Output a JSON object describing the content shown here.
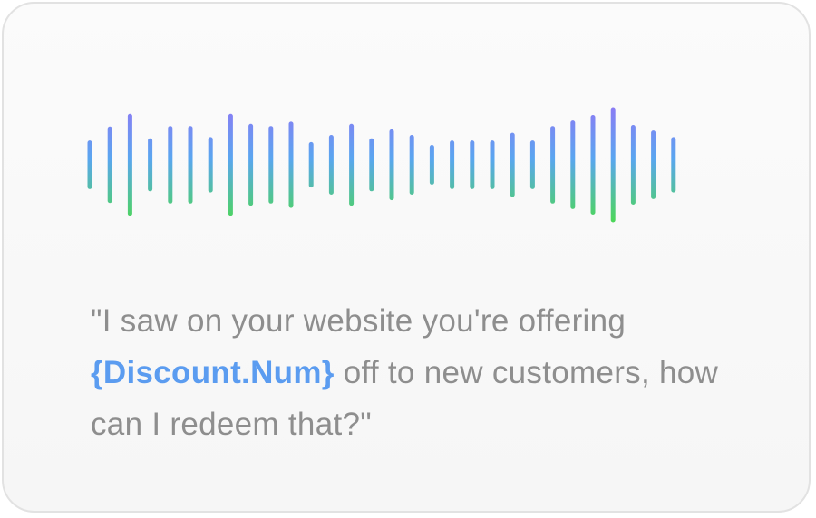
{
  "waveform": {
    "icon": "audio-waveform-icon",
    "gradient": {
      "top": "#8a7cf4",
      "middle": "#5aa6f0",
      "bottom": "#4dd65a"
    },
    "bar_levels": [
      0.4,
      0.65,
      0.88,
      0.44,
      0.66,
      0.66,
      0.46,
      0.88,
      0.7,
      0.66,
      0.74,
      0.37,
      0.5,
      0.7,
      0.44,
      0.6,
      0.5,
      0.32,
      0.4,
      0.4,
      0.4,
      0.54,
      0.4,
      0.66,
      0.76,
      0.86,
      1.0,
      0.68,
      0.58,
      0.46
    ]
  },
  "transcript": {
    "before": "\"I saw on your website you're offering ",
    "variable": "{Discount.Num}",
    "after": " off to new customers, how can I redeem that?\"",
    "colors": {
      "text": "#8e8e8e",
      "variable": "#5b9cf0"
    }
  }
}
